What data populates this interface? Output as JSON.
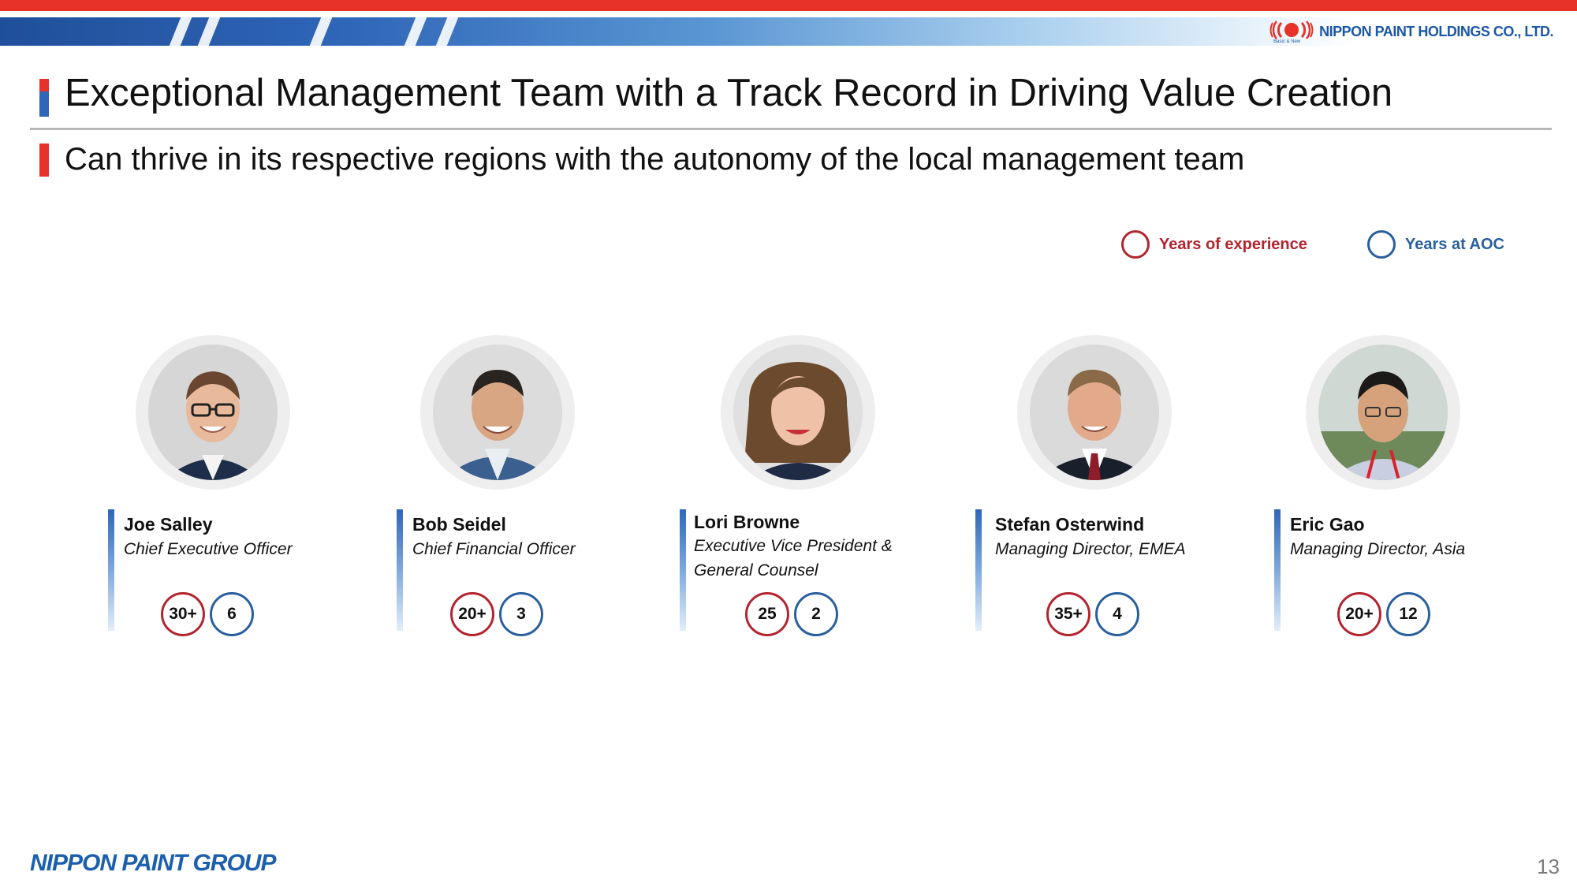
{
  "header": {
    "company": "NIPPON PAINT HOLDINGS CO., LTD.",
    "tagline": "Basic & New"
  },
  "title": "Exceptional Management Team with a Track Record in Driving Value Creation",
  "subtitle": "Can thrive in its respective regions with the autonomy of the local management team",
  "legend": {
    "experience": "Years of experience",
    "aoc": "Years at AOC"
  },
  "people": [
    {
      "name": "Joe Salley",
      "role_line1": "Chief Executive Officer",
      "role_line2": "",
      "experience": "30+",
      "aoc": "6"
    },
    {
      "name": "Bob Seidel",
      "role_line1": "Chief Financial Officer",
      "role_line2": "",
      "experience": "20+",
      "aoc": "3"
    },
    {
      "name": "Lori Browne",
      "role_line1": "Executive Vice President &",
      "role_line2": "General Counsel",
      "experience": "25",
      "aoc": "2"
    },
    {
      "name": "Stefan Osterwind",
      "role_line1": "Managing Director, EMEA",
      "role_line2": "",
      "experience": "35+",
      "aoc": "4"
    },
    {
      "name": "Eric Gao",
      "role_line1": "Managing Director, Asia",
      "role_line2": "",
      "experience": "20+",
      "aoc": "12"
    }
  ],
  "footer": {
    "group_logo": "NIPPON PAINT GROUP",
    "page_number": "13"
  },
  "colors": {
    "accent_red": "#e63228",
    "experience_ring": "#b3242e",
    "aoc_ring": "#2a5f9e",
    "brand_blue": "#1c57a6"
  }
}
